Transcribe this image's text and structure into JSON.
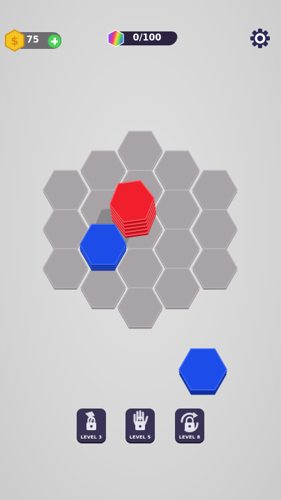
{
  "hud": {
    "coins": "75",
    "progress": "0/100"
  },
  "locked_slots": [
    {
      "label": "LEVEL 3",
      "icon": "hammer-icon"
    },
    {
      "label": "LEVEL 5",
      "icon": "hand-icon"
    },
    {
      "label": "LEVEL 8",
      "icon": "swap-icon"
    }
  ],
  "board": {
    "empty_color": "#a8a3a6",
    "stacks": [
      {
        "color": "red",
        "hex": "#f01f2b",
        "count": 5
      },
      {
        "color": "blue",
        "hex": "#1c4de8",
        "count": 3
      }
    ],
    "next_piece": {
      "color": "blue",
      "hex": "#1c4de8",
      "count": 2
    }
  }
}
